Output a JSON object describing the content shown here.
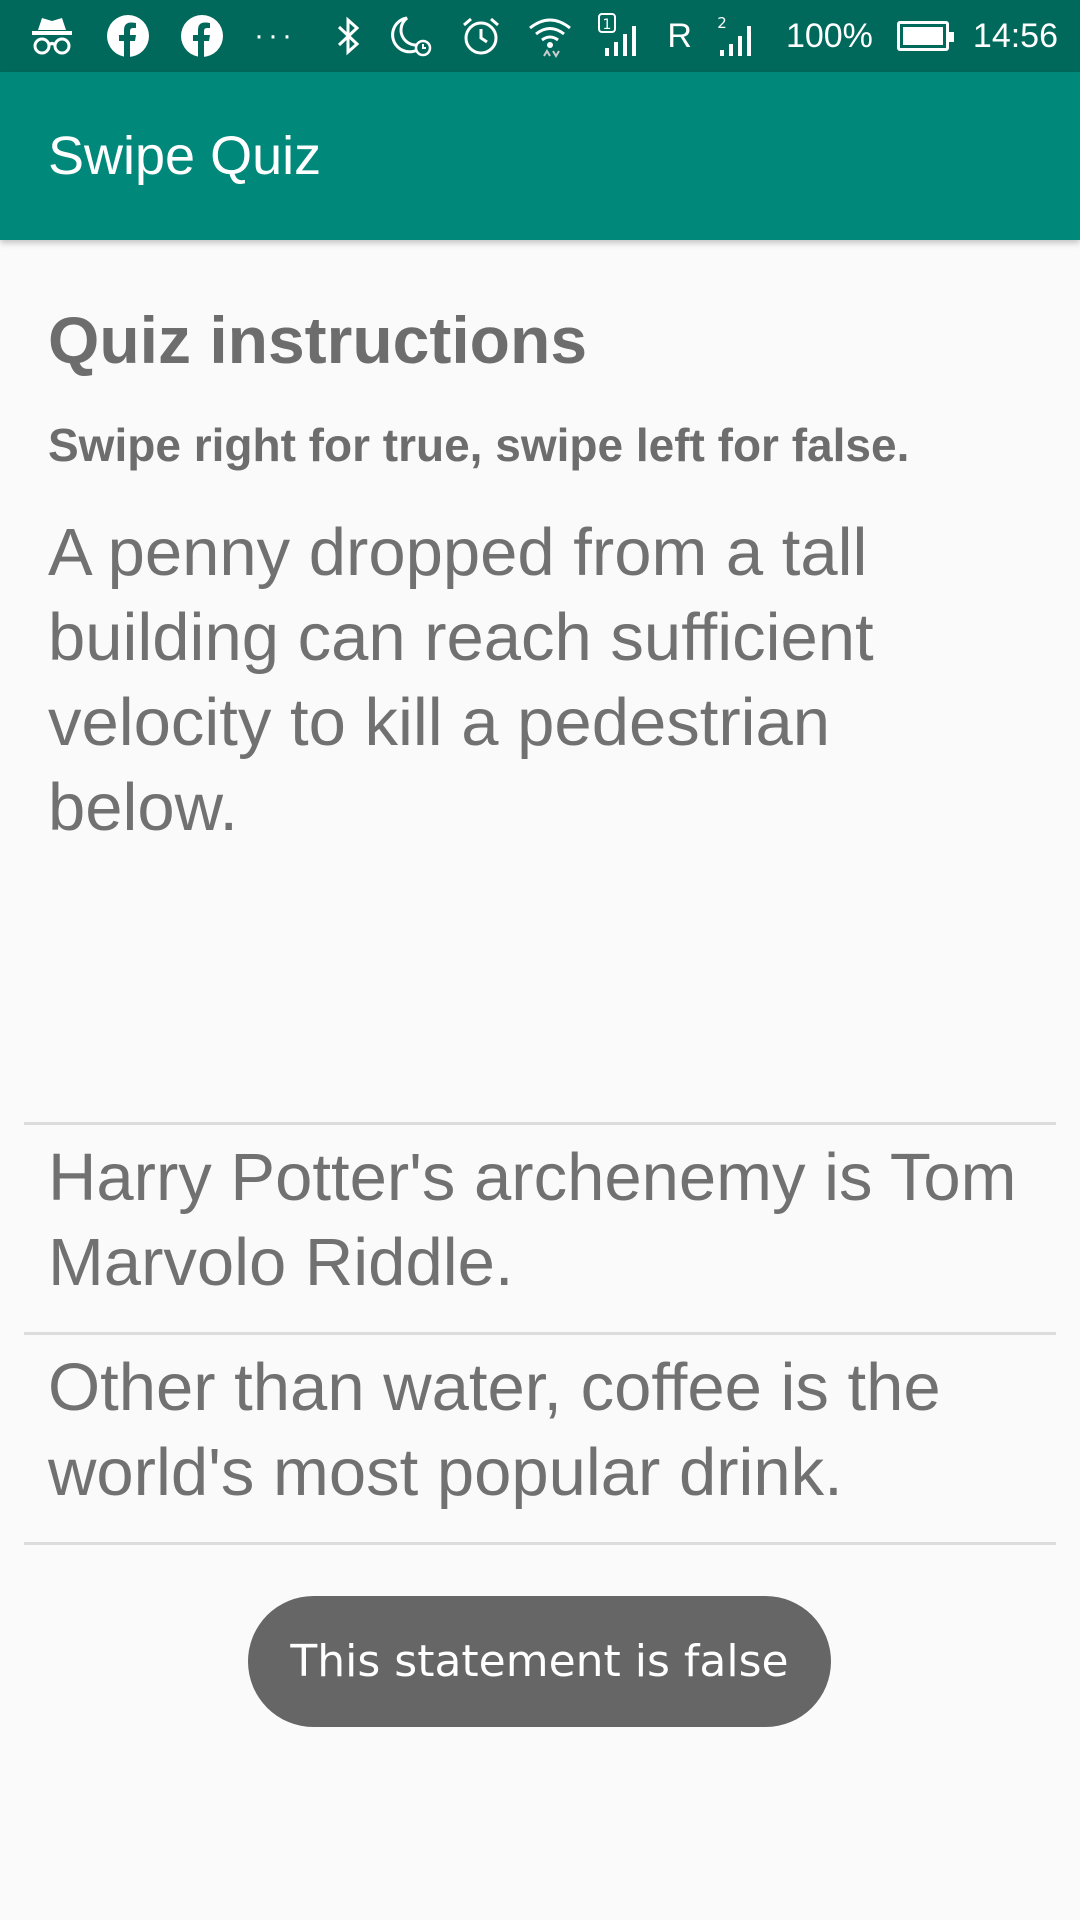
{
  "status_bar": {
    "left_icons": [
      "incognito-icon",
      "facebook-icon",
      "facebook-icon",
      "more-dots-icon"
    ],
    "dots": "···",
    "right_icons": [
      "bluetooth-icon",
      "do-not-disturb-icon",
      "alarm-icon",
      "wifi-icon",
      "signal-sim1-icon",
      "signal-sim2-icon"
    ],
    "sim1_label": "1",
    "roaming": "R",
    "sim2_label": "2",
    "battery": "100%",
    "battery_level": 1.0,
    "time": "14:56"
  },
  "app_bar": {
    "title": "Swipe Quiz",
    "color": "#00897b",
    "status_color": "#00695c"
  },
  "instructions": {
    "heading": "Quiz instructions",
    "text": "Swipe right for true, swipe left for false."
  },
  "statements": [
    "A penny dropped from a tall building can reach sufficient velocity to kill a pedestrian below.",
    "Harry Potter's archenemy is Tom Marvolo Riddle.",
    "Other than water, coffee is the world's most popular drink."
  ],
  "toast": {
    "message": "This statement is false"
  }
}
